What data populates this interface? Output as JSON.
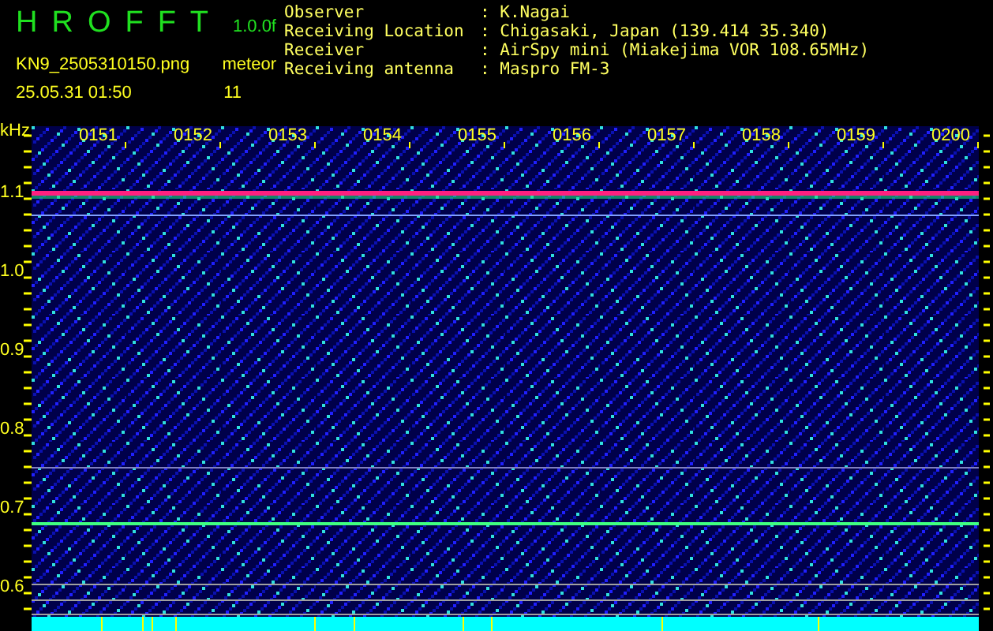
{
  "app": {
    "title": "HROFFT",
    "version": "1.0.0f"
  },
  "file": {
    "name": "KN9_2505310150.png",
    "timestamp": "25.05.31 01:50"
  },
  "meteor_count": {
    "label": "meteor",
    "value": "11"
  },
  "station": [
    {
      "label": "Observer",
      "value": ": K.Nagai"
    },
    {
      "label": "Receiving Location",
      "value": ": Chigasaki, Japan (139.414 35.340)"
    },
    {
      "label": "Receiver",
      "value": ": AirSpy mini (Miakejima VOR 108.65MHz)"
    },
    {
      "label": "Receiving antenna",
      "value": ": Maspro FM-3"
    }
  ],
  "spectrogram": {
    "y_unit": "kHz",
    "y_labels": [
      "1.1",
      "1.0",
      "0.9",
      "0.8",
      "0.7",
      "0.6"
    ],
    "time_labels": [
      "0151",
      "0152",
      "0153",
      "0154",
      "0155",
      "0156",
      "0157",
      "0158",
      "0159",
      "0200"
    ]
  }
}
